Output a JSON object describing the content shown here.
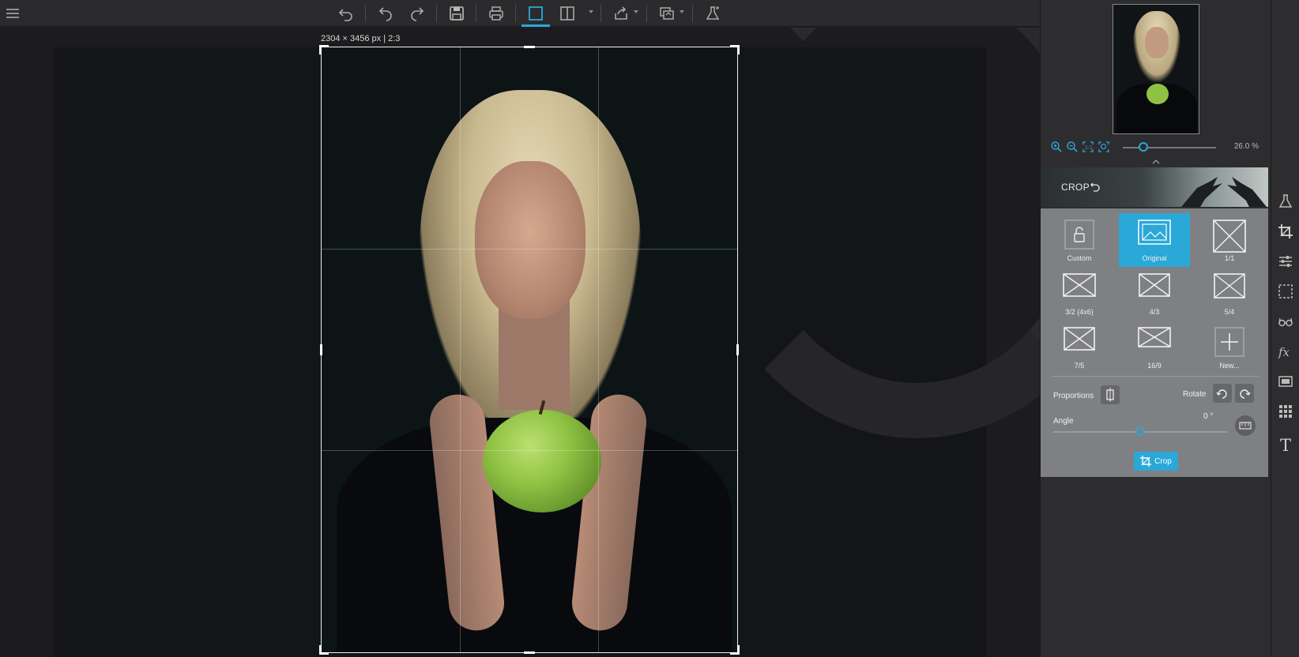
{
  "toolbar": {
    "menu_icon": "hamburger-icon",
    "buttons": [
      "undo-icon",
      "undo-step-icon",
      "redo-step-icon",
      "save-icon",
      "print-icon",
      "single-view-icon",
      "split-view-icon",
      "share-icon",
      "batch-icon",
      "lab-icon"
    ],
    "accent": "#2aa8d8"
  },
  "canvas": {
    "size_label": "2304 × 3456 px | 2:3"
  },
  "navigator": {
    "zoom_value": "26.0 %",
    "zoom_icons": [
      "zoom-in-icon",
      "zoom-out-icon",
      "fit-icon",
      "actual-size-icon"
    ]
  },
  "crop_panel": {
    "title": "CROP",
    "presets": [
      {
        "label": "Custom",
        "icon": "lock-icon",
        "selected": false
      },
      {
        "label": "Original",
        "icon": "original-ratio-icon",
        "selected": true
      },
      {
        "label": "1/1",
        "icon": "ratio-icon",
        "selected": false
      },
      {
        "label": "3/2 (4x6)",
        "icon": "ratio-icon",
        "selected": false
      },
      {
        "label": "4/3",
        "icon": "ratio-icon",
        "selected": false
      },
      {
        "label": "5/4",
        "icon": "ratio-icon",
        "selected": false
      },
      {
        "label": "7/5",
        "icon": "ratio-icon",
        "selected": false
      },
      {
        "label": "16/9",
        "icon": "ratio-icon",
        "selected": false
      },
      {
        "label": "New...",
        "icon": "plus-icon",
        "selected": false
      }
    ],
    "proportions_label": "Proportions",
    "rotate_label": "Rotate",
    "angle_label": "Angle",
    "angle_value": "0 °",
    "crop_button": "Crop"
  },
  "side_strip": [
    "lab-icon",
    "crop-icon",
    "sliders-icon",
    "selection-icon",
    "glasses-icon",
    "fx-icon",
    "frame-icon",
    "texture-icon",
    "text-icon"
  ]
}
